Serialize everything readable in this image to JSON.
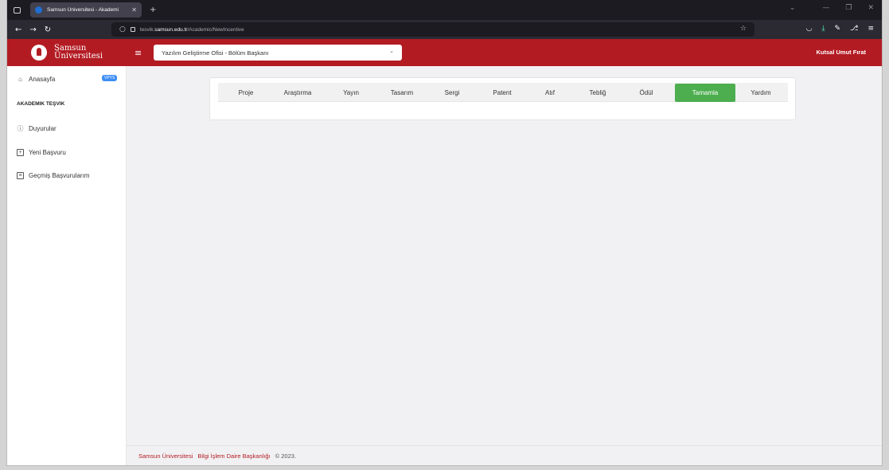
{
  "browser": {
    "tab_title": "Samsun Üniversitesi - Akademi",
    "tab_close": "✕",
    "new_tab": "+",
    "url_prefix": "tesvik.",
    "url_domain": "samsun.edu.tr",
    "url_path": "/Academic/NewIncentive",
    "accent_download": "#54ffbd"
  },
  "header": {
    "brand_line1": "Samsun",
    "brand_line2": "Üniversitesi",
    "role_select_value": "Yazılım Geliştirme Ofisi - Bölüm Başkanı",
    "user_name": "Kutsal Umut Fırat",
    "header_color": "#b31b23"
  },
  "sidebar": {
    "home_label": "Anasayfa",
    "home_badge": "VPYS",
    "section_heading": "AKADEMIK TEŞVIK",
    "items": [
      {
        "label": "Duyurular",
        "icon": "info-icon"
      },
      {
        "label": "Yeni Başvuru",
        "icon": "plus-square-icon"
      },
      {
        "label": "Geçmiş Başvurularım",
        "icon": "list-icon"
      }
    ]
  },
  "main": {
    "tabs": [
      {
        "label": "Proje"
      },
      {
        "label": "Araştırma"
      },
      {
        "label": "Yayın"
      },
      {
        "label": "Tasarım"
      },
      {
        "label": "Sergi"
      },
      {
        "label": "Patent"
      },
      {
        "label": "Atıf"
      },
      {
        "label": "Tebliğ"
      },
      {
        "label": "Ödül"
      },
      {
        "label": "Tamamla",
        "active": true
      },
      {
        "label": "Yardım"
      }
    ],
    "active_color": "#4cae4f"
  },
  "footer": {
    "org": "Samsun Üniversitesi",
    "dept": "Bilgi İşlem Daire Başkanlığı",
    "copyright": "© 2023."
  }
}
